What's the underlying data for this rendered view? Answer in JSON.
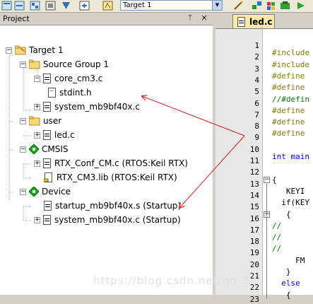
{
  "toolbar": {
    "target_value": "Target 1"
  },
  "project_panel": {
    "title": "Project",
    "pin": "ᛘ",
    "close": "×",
    "tree": [
      {
        "label": "Target 1"
      },
      {
        "label": "Source Group 1"
      },
      {
        "label": "core_cm3.c"
      },
      {
        "label": "stdint.h"
      },
      {
        "label": "system_mb9bf40x.c"
      },
      {
        "label": "user"
      },
      {
        "label": "led.c"
      },
      {
        "label": "CMSIS"
      },
      {
        "label": "RTX_Conf_CM.c (RTOS:Keil RTX)"
      },
      {
        "label": "RTX_CM3.lib (RTOS:Keil RTX)"
      },
      {
        "label": "Device"
      },
      {
        "label": "startup_mb9bf40x.s (Startup)"
      },
      {
        "label": "system_mb9bf40x.c (Startup)"
      }
    ]
  },
  "editor": {
    "tab_label": "led.c",
    "line_numbers": [
      "1",
      "2",
      "3",
      "4",
      "5",
      "6",
      "7",
      "8",
      "9",
      "10",
      "11",
      "12",
      "13",
      "14",
      "15",
      "16",
      "17",
      "18",
      "19",
      "20",
      "21",
      "22",
      "23"
    ],
    "code_lines": [
      {
        "text": "",
        "cls": "plain"
      },
      {
        "text": "#include",
        "cls": "pp"
      },
      {
        "text": "#include",
        "cls": "pp"
      },
      {
        "text": "#define",
        "cls": "pp"
      },
      {
        "text": "#define",
        "cls": "pp"
      },
      {
        "text": "//#defin",
        "cls": "cm"
      },
      {
        "text": "#define",
        "cls": "pp"
      },
      {
        "text": "#define",
        "cls": "pp"
      },
      {
        "text": "#define",
        "cls": "pp"
      },
      {
        "text": "",
        "cls": "plain"
      },
      {
        "text": "int main",
        "cls": "kw"
      },
      {
        "text": "",
        "cls": "plain"
      },
      {
        "text": "{",
        "cls": "plain"
      },
      {
        "text": "   KEYI",
        "cls": "plain"
      },
      {
        "text": "  if(KEY",
        "cls": "plain"
      },
      {
        "text": "   {",
        "cls": "plain"
      },
      {
        "text": "//",
        "cls": "cm"
      },
      {
        "text": "//",
        "cls": "cm"
      },
      {
        "text": "//",
        "cls": "cm"
      },
      {
        "text": "     FM",
        "cls": "plain"
      },
      {
        "text": "   }",
        "cls": "plain"
      },
      {
        "text": "  else",
        "cls": "kw"
      },
      {
        "text": "   {",
        "cls": "plain"
      }
    ]
  },
  "watermark": "https://blog.csdn.net/qq_3...",
  "colors": {
    "arrow": "#e02020",
    "tab_bg": "#fce9a8",
    "group_icon": "#18a818"
  }
}
